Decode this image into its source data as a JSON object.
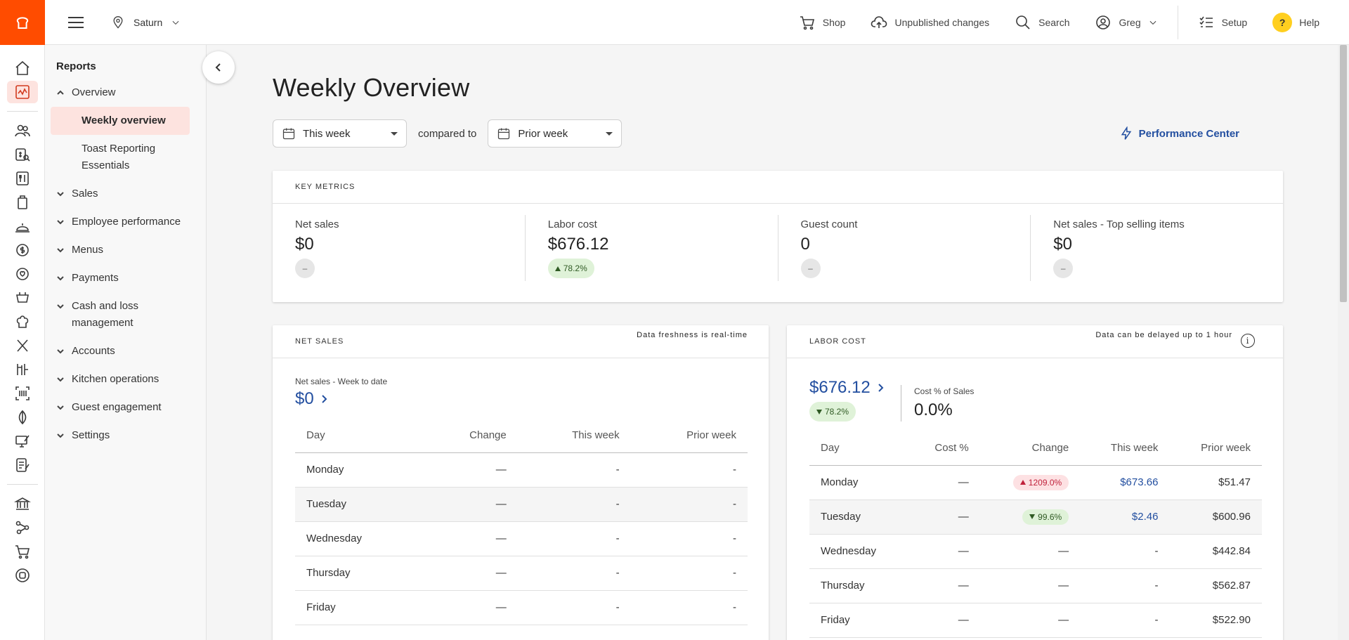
{
  "topbar": {
    "location": "Saturn",
    "shop": "Shop",
    "unpublished": "Unpublished changes",
    "search": "Search",
    "user": "Greg",
    "setup": "Setup",
    "help": "Help",
    "help_glyph": "?"
  },
  "sidebar": {
    "title": "Reports",
    "overview": "Overview",
    "sub_items": [
      "Weekly overview",
      "Toast Reporting Essentials"
    ],
    "items": [
      "Sales",
      "Employee performance",
      "Menus",
      "Payments",
      "Cash and loss management",
      "Accounts",
      "Kitchen operations",
      "Guest engagement",
      "Settings"
    ]
  },
  "page": {
    "title": "Weekly Overview",
    "period": "This week",
    "compared_to": "compared to",
    "compare_period": "Prior week",
    "performance_center": "Performance Center"
  },
  "key_metrics": {
    "heading": "KEY METRICS",
    "metrics": [
      {
        "label": "Net sales",
        "value": "$0",
        "change": "–",
        "change_type": "neutral"
      },
      {
        "label": "Labor cost",
        "value": "$676.12",
        "change": "78.2%",
        "change_type": "up"
      },
      {
        "label": "Guest count",
        "value": "0",
        "change": "–",
        "change_type": "neutral"
      },
      {
        "label": "Net sales - Top selling items",
        "value": "$0",
        "change": "–",
        "change_type": "neutral"
      }
    ]
  },
  "net_sales": {
    "heading": "NET SALES",
    "freshness": "Data freshness is real-time",
    "sub_label": "Net sales - Week to date",
    "value": "$0",
    "columns": [
      "Day",
      "Change",
      "This week",
      "Prior week"
    ],
    "rows": [
      [
        "Monday",
        "—",
        "-",
        "-"
      ],
      [
        "Tuesday",
        "—",
        "-",
        "-"
      ],
      [
        "Wednesday",
        "—",
        "-",
        "-"
      ],
      [
        "Thursday",
        "—",
        "-",
        "-"
      ],
      [
        "Friday",
        "—",
        "-",
        "-"
      ]
    ]
  },
  "labor_cost": {
    "heading": "LABOR COST",
    "freshness": "Data can be delayed up to 1 hour",
    "info_glyph": "i",
    "value": "$676.12",
    "change": "78.2%",
    "cost_pct_label": "Cost % of Sales",
    "cost_pct_value": "0.0%",
    "columns": [
      "Day",
      "Cost %",
      "Change",
      "This week",
      "Prior week"
    ],
    "rows": [
      [
        "Monday",
        "—",
        "1209.0%",
        "$673.66",
        "$51.47"
      ],
      [
        "Tuesday",
        "—",
        "99.6%",
        "$2.46",
        "$600.96"
      ],
      [
        "Wednesday",
        "—",
        "—",
        "-",
        "$442.84"
      ],
      [
        "Thursday",
        "—",
        "—",
        "-",
        "$562.87"
      ],
      [
        "Friday",
        "—",
        "—",
        "-",
        "$522.90"
      ]
    ]
  },
  "colors": {
    "brand": "#ff4c00",
    "link": "#234fa0",
    "positive_bg": "#dff2d8",
    "negative_bg": "#fde1e3"
  }
}
